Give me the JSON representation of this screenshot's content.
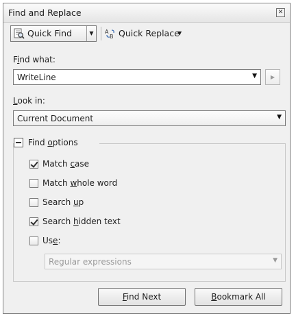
{
  "window": {
    "title": "Find and Replace",
    "close_glyph": "✕"
  },
  "toolbar": {
    "quick_find": "Quick Find",
    "quick_replace": "Quick Replace",
    "icons": [
      "quick-find-icon",
      "quick-replace-icon"
    ]
  },
  "find_what": {
    "label_access": "i",
    "label_pre": "F",
    "label_post": "nd what:",
    "value": "WriteLine"
  },
  "look_in": {
    "label_access": "L",
    "label_post": "ook in:",
    "value": "Current Document"
  },
  "options": {
    "header_pre": "Find ",
    "header_access": "o",
    "header_post": "ptions",
    "items": [
      {
        "pre": "Match ",
        "access": "c",
        "post": "ase",
        "checked": true
      },
      {
        "pre": "Match ",
        "access": "w",
        "post": "hole word",
        "checked": false
      },
      {
        "pre": "Search ",
        "access": "u",
        "post": "p",
        "checked": false
      },
      {
        "pre": "Search ",
        "access": "h",
        "post": "idden text",
        "checked": true
      },
      {
        "pre": "Us",
        "access": "e",
        "post": ":",
        "checked": false
      }
    ],
    "use_type": "Regular expressions"
  },
  "buttons": {
    "find_next_access": "F",
    "find_next_post": "ind Next",
    "bookmark_access": "B",
    "bookmark_post": "ookmark All"
  },
  "colors": {
    "border": "#7f7f7f",
    "panel": "#f0f0f0",
    "disabled_text": "#9a9a9a"
  }
}
